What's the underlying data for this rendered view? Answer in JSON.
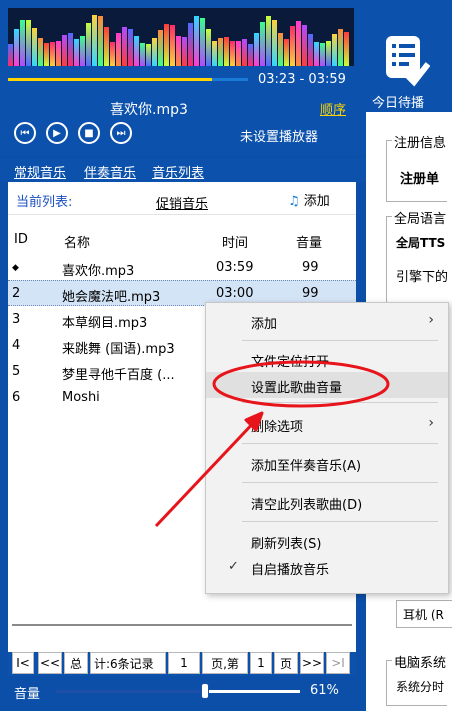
{
  "player": {
    "time": "03:23 - 03:59",
    "progress": 0.85,
    "song": "喜欢你.mp3",
    "order": "顺序",
    "status": "未设置播放器",
    "controls": [
      "prev-icon",
      "play-icon",
      "stop-icon",
      "next-icon"
    ]
  },
  "tabs": [
    "常规音乐",
    "伴奏音乐",
    "音乐列表"
  ],
  "list": {
    "current_label": "当前列表:",
    "current_value": "促销音乐",
    "add_label": "添加",
    "headers": [
      "ID",
      "名称",
      "时间",
      "音量"
    ],
    "rows": [
      {
        "id": "◆",
        "name": "喜欢你.mp3",
        "time": "03:59",
        "volume": "99"
      },
      {
        "id": "2",
        "name": "她会魔法吧.mp3",
        "time": "03:00",
        "volume": "99"
      },
      {
        "id": "3",
        "name": "本草纲目.mp3",
        "time": "",
        "volume": ""
      },
      {
        "id": "4",
        "name": "来跳舞 (国语).mp3",
        "time": "",
        "volume": ""
      },
      {
        "id": "5",
        "name": "梦里寻他千百度 (...",
        "time": "",
        "volume": ""
      },
      {
        "id": "6",
        "name": "Moshi",
        "time": "",
        "volume": ""
      }
    ]
  },
  "pager": {
    "first": "I<",
    "prev": "<<",
    "total_label": "总",
    "count": "计:6条记录",
    "page": "1",
    "page_label": "页,第",
    "current_page": "1",
    "page_suffix": "页",
    "next": ">>",
    "last": ">I"
  },
  "volume": {
    "label": "音量",
    "value": "61%",
    "level": 0.61
  },
  "right": {
    "title": "今日待播",
    "reg_section": "注册信息",
    "reg_item": "注册单",
    "lang_section": "全局语言",
    "tts": "全局TTS",
    "engine": "引擎下的",
    "device": "耳机 (R",
    "sys_section": "电脑系统",
    "sys_item": "系统分时"
  },
  "menu": {
    "items": [
      {
        "label": "添加",
        "submenu": true
      },
      {
        "label": "文件定位打开",
        "submenu": false
      },
      {
        "label": "设置此歌曲音量",
        "submenu": false
      },
      {
        "label": "删除选项",
        "submenu": true
      },
      {
        "label": "添加至伴奏音乐(A)",
        "submenu": false
      },
      {
        "label": "清空此列表歌曲(D)",
        "submenu": false
      },
      {
        "label": "刷新列表(S)",
        "submenu": false
      },
      {
        "label": "自启播放音乐",
        "submenu": false,
        "checked": true
      }
    ]
  },
  "annotation": {
    "color": "#e8141b"
  }
}
